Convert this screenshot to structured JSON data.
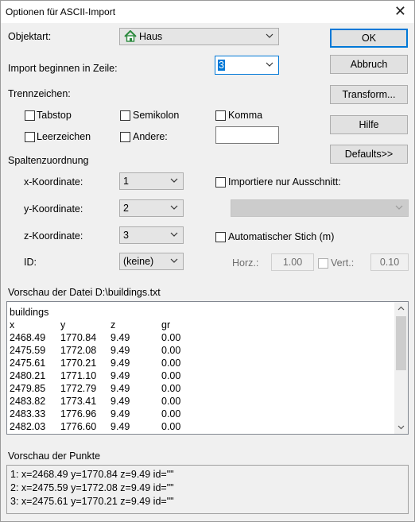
{
  "window": {
    "title": "Optionen für ASCII-Import",
    "close_symbol": "✕"
  },
  "objektart": {
    "label": "Objektart:",
    "value": "Haus",
    "icon": "house-icon"
  },
  "import_start": {
    "label": "Import beginnen in Zeile:",
    "value": "3"
  },
  "buttons": {
    "ok": "OK",
    "abbruch": "Abbruch",
    "transform": "Transform...",
    "hilfe": "Hilfe",
    "defaults": "Defaults>>"
  },
  "trennzeichen": {
    "label": "Trennzeichen:",
    "tabstop": "Tabstop",
    "semikolon": "Semikolon",
    "komma": "Komma",
    "leerzeichen": "Leerzeichen",
    "andere": "Andere:",
    "andere_value": ""
  },
  "spalten": {
    "label": "Spaltenzuordnung",
    "x_label": "x-Koordinate:",
    "x_value": "1",
    "y_label": "y-Koordinate:",
    "y_value": "2",
    "z_label": "z-Koordinate:",
    "z_value": "3",
    "id_label": "ID:",
    "id_value": "(keine)"
  },
  "ausschnitt": {
    "label": "Importiere nur Ausschnitt:",
    "value": ""
  },
  "stich": {
    "label": "Automatischer Stich (m)",
    "horz_label": "Horz.:",
    "horz_value": "1.00",
    "vert_label": "Vert.:",
    "vert_value": "0.10"
  },
  "file_preview": {
    "label": "Vorschau der Datei D:\\buildings.txt",
    "first_line": "buildings",
    "columns": [
      "x",
      "y",
      "z",
      "gr"
    ],
    "rows": [
      [
        "2468.49",
        "1770.84",
        "9.49",
        "0.00"
      ],
      [
        "2475.59",
        "1772.08",
        "9.49",
        "0.00"
      ],
      [
        "2475.61",
        "1770.21",
        "9.49",
        "0.00"
      ],
      [
        "2480.21",
        "1771.10",
        "9.49",
        "0.00"
      ],
      [
        "2479.85",
        "1772.79",
        "9.49",
        "0.00"
      ],
      [
        "2483.82",
        "1773.41",
        "9.49",
        "0.00"
      ],
      [
        "2483.33",
        "1776.96",
        "9.49",
        "0.00"
      ],
      [
        "2482.03",
        "1776.60",
        "9.49",
        "0.00"
      ]
    ]
  },
  "points_preview": {
    "label": "Vorschau der Punkte",
    "lines": [
      "1: x=2468.49 y=1770.84 z=9.49 id=\"\"",
      "2: x=2475.59 y=1772.08 z=9.49 id=\"\"",
      "3: x=2475.61 y=1770.21 z=9.49 id=\"\""
    ]
  }
}
